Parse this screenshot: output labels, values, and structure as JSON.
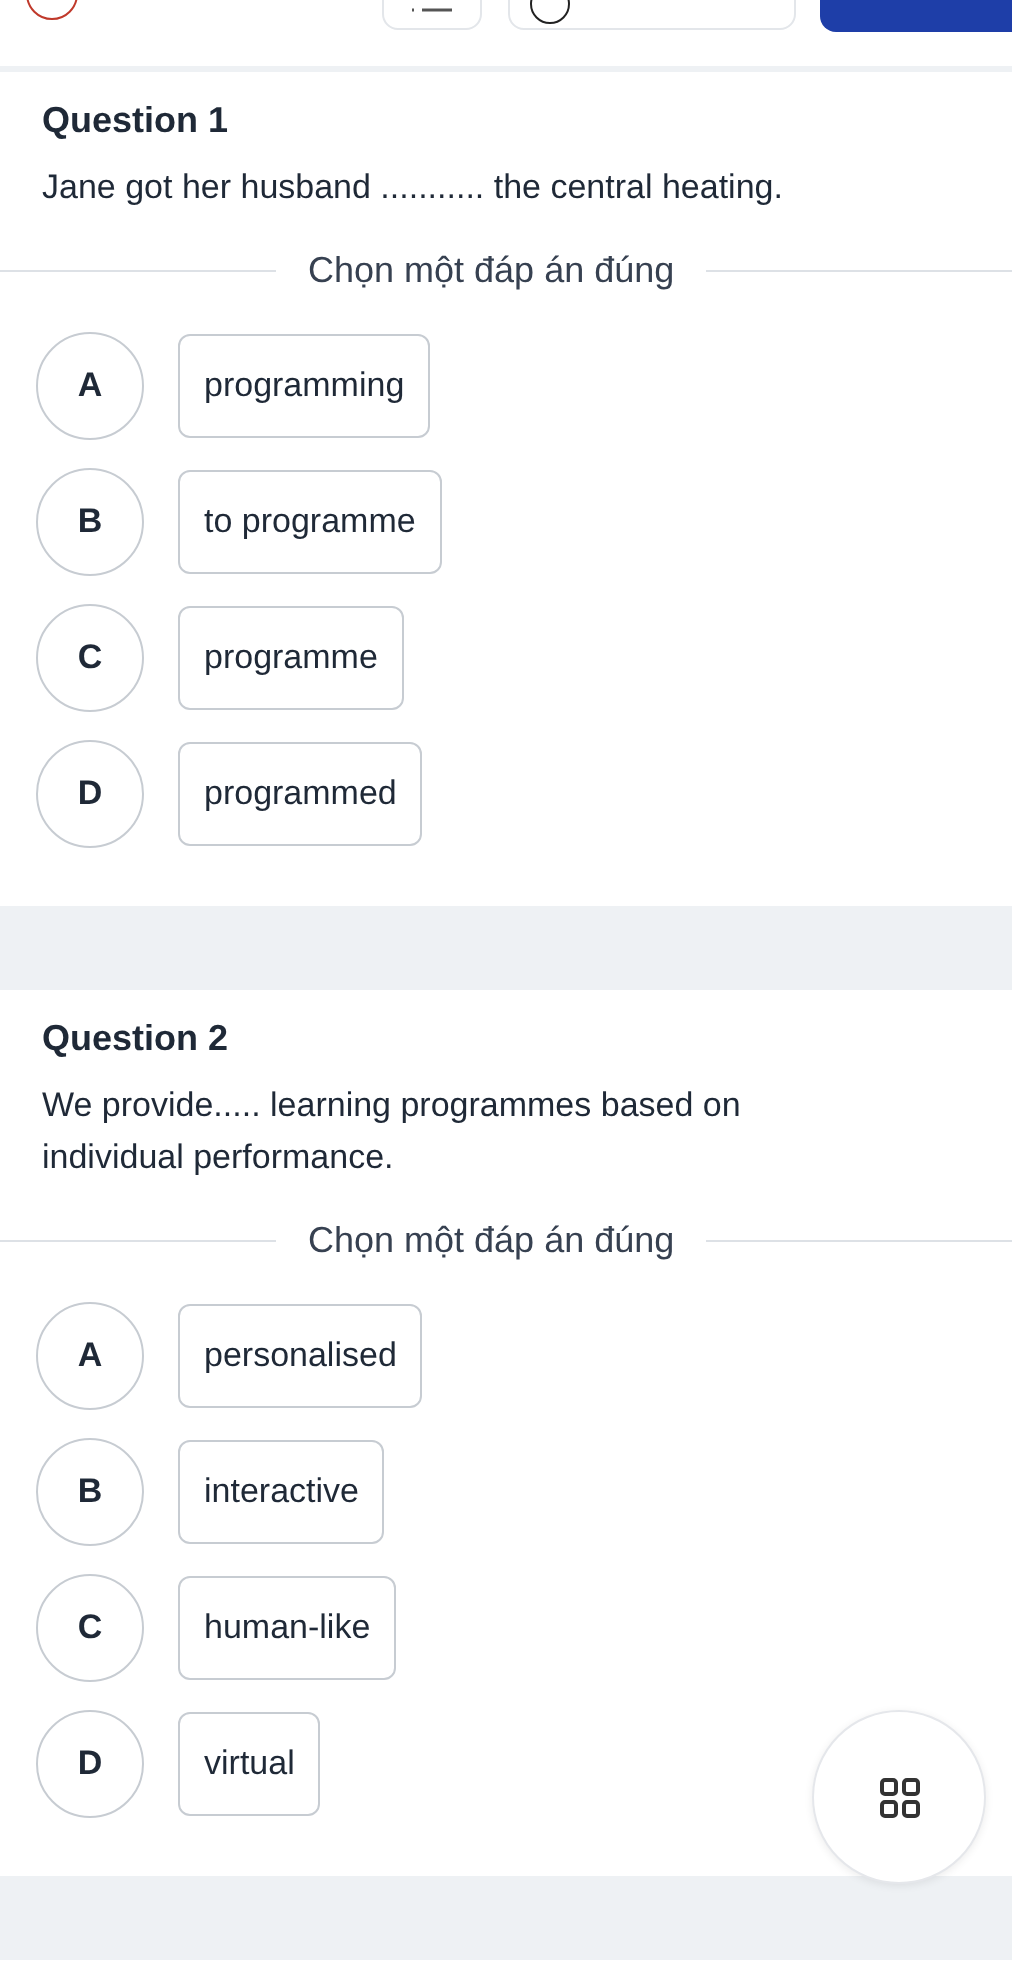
{
  "questions": [
    {
      "title": "Question 1",
      "text": "Jane got her husband ........... the central heating.",
      "prompt": "Chọn một đáp án đúng",
      "options": [
        {
          "letter": "A",
          "text": "programming"
        },
        {
          "letter": "B",
          "text": "to programme"
        },
        {
          "letter": "C",
          "text": "programme"
        },
        {
          "letter": "D",
          "text": "programmed"
        }
      ]
    },
    {
      "title": "Question 2",
      "text": "We provide..... learning programmes based on individual performance.",
      "prompt": "Chọn một đáp án đúng",
      "options": [
        {
          "letter": "A",
          "text": "personalised"
        },
        {
          "letter": "B",
          "text": "interactive"
        },
        {
          "letter": "C",
          "text": "human-like"
        },
        {
          "letter": "D",
          "text": "virtual"
        }
      ]
    }
  ]
}
